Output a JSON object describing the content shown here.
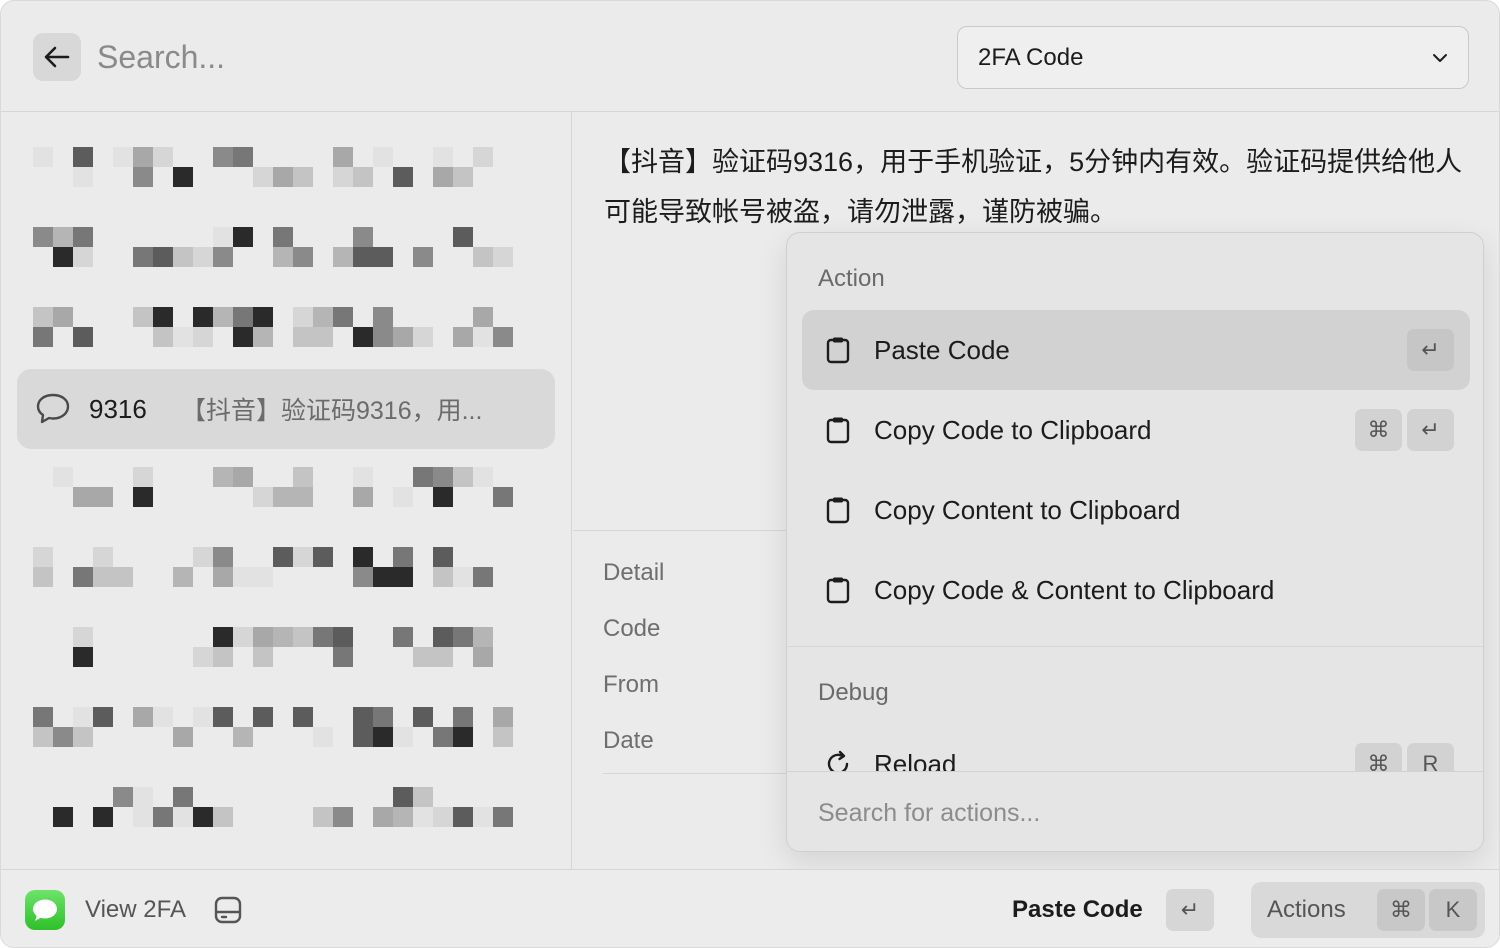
{
  "search": {
    "placeholder": "Search..."
  },
  "filter_dropdown": {
    "value": "2FA Code"
  },
  "list": {
    "selected_item": {
      "code": "9316",
      "preview": "【抖音】验证码9316，用..."
    }
  },
  "detail": {
    "message": "【抖音】验证码9316，用于手机验证，5分钟内有效。验证码提供给他人可能导致帐号被盗，请勿泄露，谨防被骗。",
    "metadata_labels": [
      "Detail",
      "Code",
      "From",
      "Date"
    ]
  },
  "action_panel": {
    "sections": [
      {
        "title": "Action",
        "items": [
          {
            "label": "Paste Code",
            "icon": "clipboard-icon",
            "keys": [
              "↵"
            ],
            "selected": true
          },
          {
            "label": "Copy Code to Clipboard",
            "icon": "clipboard-icon",
            "keys": [
              "⌘",
              "↵"
            ]
          },
          {
            "label": "Copy Content to Clipboard",
            "icon": "clipboard-icon",
            "keys": []
          },
          {
            "label": "Copy Code & Content to Clipboard",
            "icon": "clipboard-icon",
            "keys": []
          }
        ]
      },
      {
        "title": "Debug",
        "items": [
          {
            "label": "Reload",
            "icon": "reload-icon",
            "keys": [
              "⌘",
              "R"
            ]
          }
        ]
      }
    ],
    "search_placeholder": "Search for actions..."
  },
  "footer": {
    "title": "View 2FA",
    "primary_action": "Paste Code",
    "primary_key": "↵",
    "actions_label": "Actions",
    "actions_keys": [
      "⌘",
      "K"
    ]
  }
}
